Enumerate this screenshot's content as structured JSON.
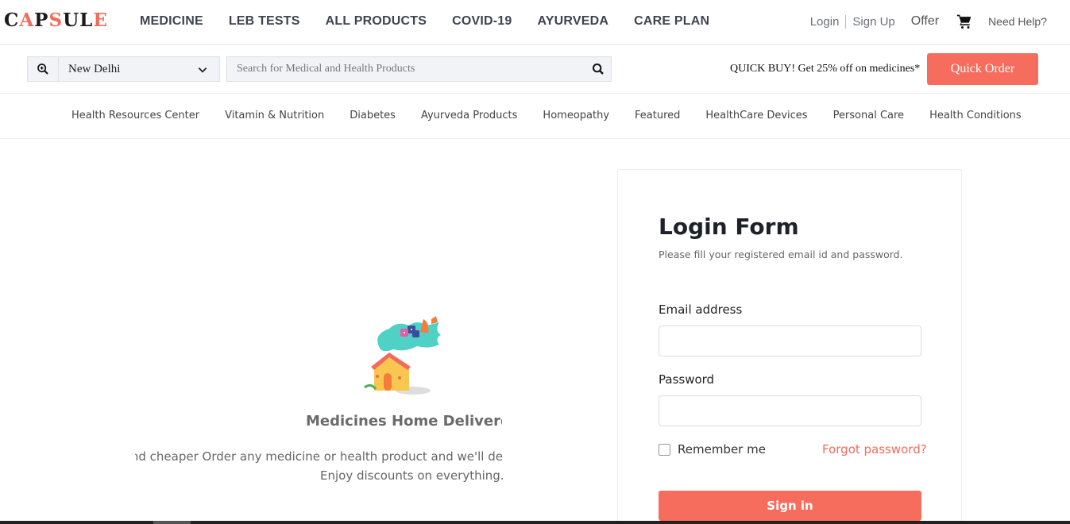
{
  "brand": {
    "logo_parts": [
      "C",
      "A",
      "P",
      "S",
      "U",
      "L",
      "E"
    ]
  },
  "nav": {
    "items": [
      "MEDICINE",
      "LEB TESTS",
      "ALL PRODUCTS",
      "COVID-19",
      "AYURVEDA",
      "CARE PLAN"
    ],
    "login": "Login",
    "signup": "Sign Up",
    "offer": "Offer",
    "cart_icon": "cart-icon",
    "help": "Need Help?"
  },
  "search": {
    "location": "New Delhi",
    "placeholder": "Search for Medical and Health Products",
    "promo": "QUICK BUY! Get 25% off on medicines*",
    "quick_order": "Quick Order"
  },
  "categories": [
    "Health Resources Center",
    "Vitamin & Nutrition",
    "Diabetes",
    "Ayurveda Products",
    "Homeopathy",
    "Featured",
    "HealthCare Devices",
    "Personal Care",
    "Health Conditions"
  ],
  "hero": {
    "title": "Medicines Home Delivered",
    "text": "ts and cheaper  Order any medicine or health product and we'll de",
    "subtext": "Enjoy discounts on everything."
  },
  "login_form": {
    "title": "Login Form",
    "subtitle": "Please fill your registered email id and password.",
    "email_label": "Email address",
    "email_value": "",
    "password_label": "Password",
    "password_value": "",
    "remember": "Remember me",
    "forgot": "Forgot password?",
    "signin": "Sign in"
  },
  "colors": {
    "accent": "#f66d5d",
    "link": "#f26b5b",
    "nav_text": "#3d4451"
  }
}
